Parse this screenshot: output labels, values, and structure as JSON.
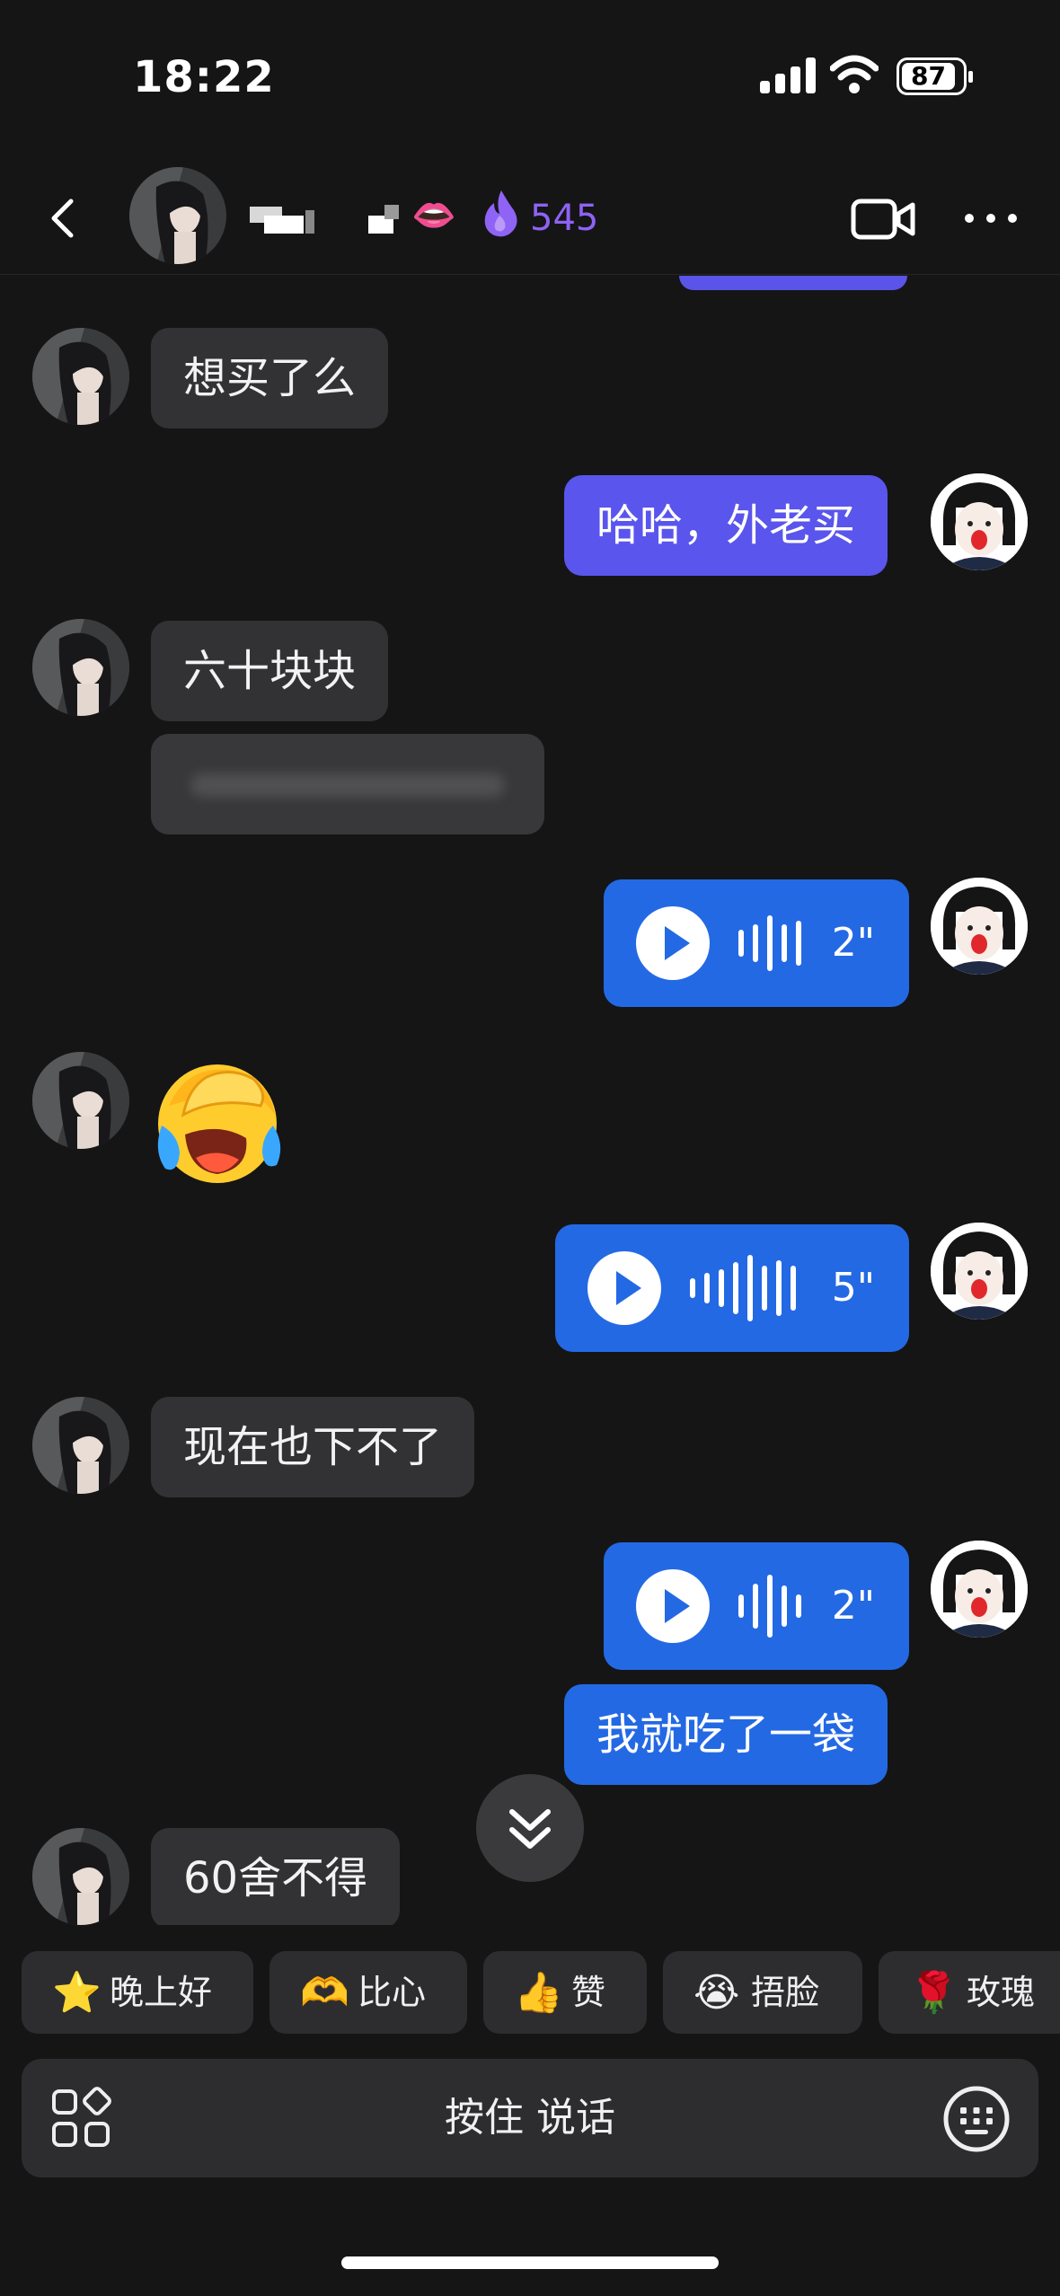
{
  "status_bar": {
    "time": "18:22",
    "battery": "87"
  },
  "header": {
    "contact_name": "",
    "flame_count": "545",
    "icons": [
      "back-icon",
      "lips-icon",
      "flame-icon",
      "video-call-icon",
      "more-icon"
    ]
  },
  "messages": [
    {
      "from": "them",
      "type": "text",
      "text": "想买了么"
    },
    {
      "from": "me",
      "type": "text",
      "text": "哈哈，外老买"
    },
    {
      "from": "them",
      "type": "text",
      "text": "六十块块"
    },
    {
      "from": "them",
      "type": "blurred",
      "text": ""
    },
    {
      "from": "me",
      "type": "voice",
      "duration": "2\""
    },
    {
      "from": "them",
      "type": "emoji",
      "emoji": "facepalm-crying"
    },
    {
      "from": "me",
      "type": "voice",
      "duration": "5\""
    },
    {
      "from": "them",
      "type": "text",
      "text": "现在也下不了"
    },
    {
      "from": "me",
      "type": "voice",
      "duration": "2\""
    },
    {
      "from": "me",
      "type": "text",
      "text": "我就吃了一袋"
    },
    {
      "from": "them",
      "type": "text",
      "text": "60舍不得"
    }
  ],
  "quick_replies": [
    {
      "icon": "star-emoji",
      "label": "晚上好"
    },
    {
      "icon": "heart-hands-emoji",
      "label": "比心"
    },
    {
      "icon": "thumbs-up-emoji",
      "label": "赞"
    },
    {
      "icon": "facepalm-emoji",
      "label": "捂脸"
    },
    {
      "icon": "rose-emoji",
      "label": "玫瑰"
    }
  ],
  "input": {
    "hold_to_talk": "按住 说话"
  },
  "colors": {
    "background": "#151516",
    "incoming": "#323234",
    "outgoing_purple": "#5a55ec",
    "outgoing_blue": "#2469e4",
    "flame": "#8e63f5"
  }
}
